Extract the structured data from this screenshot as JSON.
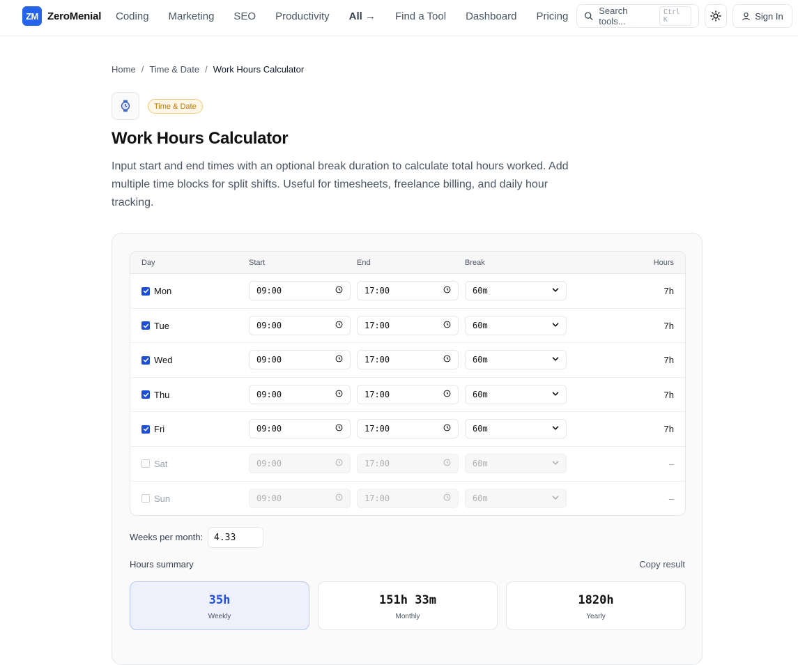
{
  "brand": {
    "logo_mark": "ZM",
    "name": "ZeroMenial",
    "accent": "#2563eb"
  },
  "nav": [
    {
      "label": "Coding"
    },
    {
      "label": "Marketing"
    },
    {
      "label": "SEO"
    },
    {
      "label": "Productivity"
    },
    {
      "label": "All →"
    },
    {
      "label": "Find a Tool"
    },
    {
      "label": "Dashboard"
    },
    {
      "label": "Pricing"
    }
  ],
  "search": {
    "placeholder": "Search tools...",
    "shortcut": "Ctrl K"
  },
  "account": {
    "sign_in_label": "Sign In"
  },
  "breadcrumb": {
    "home": "Home",
    "category": "Time & Date",
    "current": "Work Hours Calculator"
  },
  "tool": {
    "icon": "watch-icon",
    "category_badge": "Time & Date",
    "title": "Work Hours Calculator",
    "description": "Input start and end times with an optional break duration to calculate total hours worked. Add multiple time blocks for split shifts. Useful for timesheets, freelance billing, and daily hour tracking."
  },
  "table": {
    "headers": {
      "day": "Day",
      "start": "Start",
      "end": "End",
      "break": "Break",
      "hours": "Hours"
    },
    "rows": [
      {
        "day": "Mon",
        "checked": true,
        "start": "09:00",
        "end": "17:00",
        "break": "60m",
        "hours": "7h"
      },
      {
        "day": "Tue",
        "checked": true,
        "start": "09:00",
        "end": "17:00",
        "break": "60m",
        "hours": "7h"
      },
      {
        "day": "Wed",
        "checked": true,
        "start": "09:00",
        "end": "17:00",
        "break": "60m",
        "hours": "7h"
      },
      {
        "day": "Thu",
        "checked": true,
        "start": "09:00",
        "end": "17:00",
        "break": "60m",
        "hours": "7h"
      },
      {
        "day": "Fri",
        "checked": true,
        "start": "09:00",
        "end": "17:00",
        "break": "60m",
        "hours": "7h"
      },
      {
        "day": "Sat",
        "checked": false,
        "start": "09:00",
        "end": "17:00",
        "break": "60m",
        "hours": "–"
      },
      {
        "day": "Sun",
        "checked": false,
        "start": "09:00",
        "end": "17:00",
        "break": "60m",
        "hours": "–"
      }
    ]
  },
  "weeks_per_month": {
    "label": "Weeks per month:",
    "value": "4.33"
  },
  "summary": {
    "label": "Hours summary",
    "copy_label": "Copy result",
    "cards": [
      {
        "value": "35h",
        "label": "Weekly",
        "active": true
      },
      {
        "value": "151h 33m",
        "label": "Monthly",
        "active": false
      },
      {
        "value": "1820h",
        "label": "Yearly",
        "active": false
      }
    ]
  }
}
